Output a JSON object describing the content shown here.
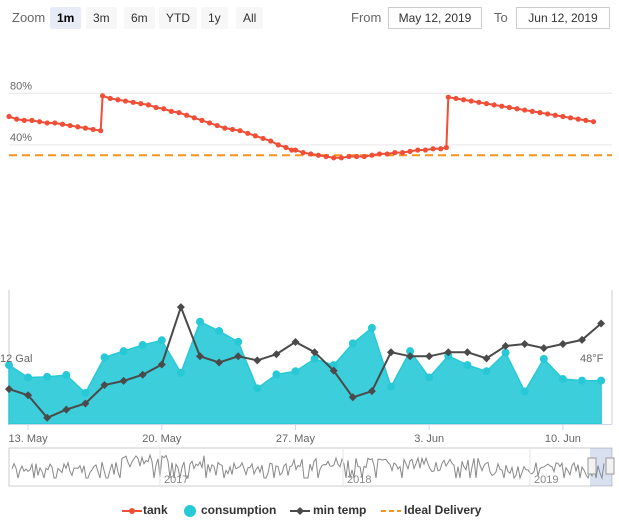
{
  "toolbar": {
    "zoom_label": "Zoom",
    "buttons": [
      "1m",
      "3m",
      "6m",
      "YTD",
      "1y",
      "All"
    ],
    "active": "1m",
    "from_label": "From",
    "from_value": "May 12, 2019",
    "to_label": "To",
    "to_value": "Jun 12, 2019"
  },
  "colors": {
    "tank": "#f04e37",
    "consumption": "#27c9d6",
    "min_temp": "#4a4a4a",
    "ideal": "#f7941d"
  },
  "chart_data": {
    "type": "line",
    "x_ticks": [
      "13. May",
      "20. May",
      "27. May",
      "3. Jun",
      "10. Jun"
    ],
    "x_tick_days": [
      13,
      20,
      27,
      34,
      41
    ],
    "upper_panel": {
      "y_ticks": [
        "80%",
        "40%"
      ],
      "y_tick_values": [
        80,
        40
      ],
      "ylim": [
        0,
        100
      ],
      "ideal_delivery": 32,
      "tank": {
        "name": "tank",
        "segments": [
          {
            "x": [
              12.0,
              12.4,
              12.8,
              13.2,
              13.6,
              14.0,
              14.4,
              14.8,
              15.2,
              15.6,
              16.0,
              16.4,
              16.8
            ],
            "y": [
              62,
              60,
              59,
              59,
              58,
              57,
              57,
              56,
              55,
              54,
              53,
              52,
              51
            ]
          },
          {
            "x": [
              16.9,
              17.3,
              17.7,
              18.1,
              18.5,
              18.9,
              19.3,
              19.7,
              20.1,
              20.5,
              20.9,
              21.3,
              21.7,
              22.1,
              22.5,
              22.9,
              23.3,
              23.7,
              24.1,
              24.5,
              24.9,
              25.3,
              25.7,
              26.1,
              26.5,
              26.8
            ],
            "y": [
              78,
              76,
              75,
              74,
              73,
              72,
              71,
              69,
              68,
              66,
              65,
              63,
              61,
              59,
              57,
              55,
              53,
              52,
              51,
              49,
              47,
              45,
              43,
              40,
              38,
              36
            ]
          },
          {
            "x": [
              27.0,
              27.4,
              27.8,
              28.2,
              28.6,
              29.0,
              29.4,
              29.8,
              30.2,
              30.6,
              31.0,
              31.4,
              31.8,
              32.2,
              32.6,
              33.0,
              33.4,
              33.8,
              34.2,
              34.6,
              34.9
            ],
            "y": [
              36,
              34,
              33,
              32,
              31,
              30,
              30,
              31,
              31,
              31,
              32,
              33,
              33,
              34,
              34,
              35,
              36,
              36,
              37,
              37,
              38
            ]
          },
          {
            "x": [
              35.0,
              35.4,
              35.8,
              36.2,
              36.6,
              37.0,
              37.4,
              37.8,
              38.2,
              38.6,
              39.0,
              39.4,
              39.8,
              40.2,
              40.6,
              41.0,
              41.4,
              41.8,
              42.2,
              42.6
            ],
            "y": [
              77,
              76,
              75,
              74,
              73,
              72,
              71,
              70,
              69,
              68,
              67,
              66,
              65,
              64,
              63,
              62,
              61,
              60,
              59,
              58
            ]
          }
        ]
      }
    },
    "lower_panel": {
      "left_label": "12 Gal",
      "right_label": "48°F",
      "consumption": {
        "name": "consumption",
        "x": [
          12.0,
          13.0,
          14.0,
          15.0,
          16.0,
          17.0,
          18.0,
          19.0,
          20.0,
          21.0,
          22.0,
          23.0,
          24.0,
          25.0,
          26.0,
          27.0,
          28.0,
          29.0,
          30.0,
          31.0,
          32.0,
          33.0,
          34.0,
          35.0,
          36.0,
          37.0,
          38.0,
          39.0,
          40.0,
          41.0,
          42.0,
          43.0
        ],
        "y": [
          19.0,
          15.0,
          15.2,
          15.8,
          10.0,
          21.5,
          23.5,
          25.5,
          27.0,
          16.5,
          33.0,
          30.0,
          26.5,
          11.5,
          16.0,
          17.0,
          21.0,
          19.0,
          26.0,
          31.0,
          12.0,
          23.5,
          15.0,
          22.0,
          19.0,
          17.0,
          23.0,
          10.5,
          21.0,
          14.5,
          14.0,
          14.0
        ]
      },
      "min_temp": {
        "name": "min temp",
        "x": [
          12.0,
          13.0,
          14.0,
          15.0,
          16.0,
          17.0,
          18.0,
          19.0,
          20.0,
          21.0,
          22.0,
          23.0,
          24.0,
          25.0,
          26.0,
          27.0,
          28.0,
          29.0,
          30.0,
          31.0,
          32.0,
          33.0,
          34.0,
          35.0,
          36.0,
          37.0,
          38.0,
          39.0,
          40.0,
          41.0,
          42.0,
          43.0
        ],
        "y": [
          49.0,
          47.5,
          42.0,
          44.0,
          45.5,
          50.0,
          51.0,
          52.5,
          55.0,
          69.0,
          57.0,
          55.5,
          57.0,
          56.0,
          57.5,
          60.5,
          58.0,
          53.5,
          47.0,
          48.5,
          58.0,
          57.0,
          57.0,
          58.0,
          58.0,
          56.5,
          59.5,
          60.0,
          59.0,
          60.0,
          61.0,
          65.0
        ]
      }
    },
    "navigator": {
      "labels": [
        "2017",
        "2018",
        "2019"
      ]
    },
    "legend": [
      "tank",
      "consumption",
      "min temp",
      "Ideal Delivery"
    ]
  }
}
